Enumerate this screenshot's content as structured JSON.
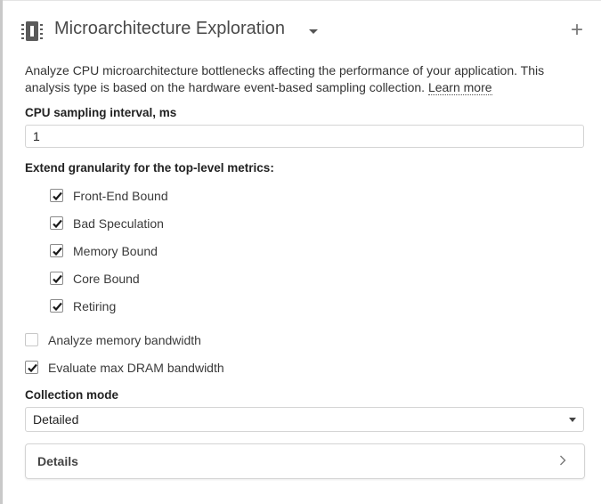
{
  "header": {
    "title": "Microarchitecture Exploration",
    "icon": "chip-icon",
    "add_icon": "plus-icon",
    "add_glyph": "+"
  },
  "description": {
    "text": "Analyze CPU microarchitecture bottlenecks affecting the performance of your application. This analysis type is based on the hardware event-based sampling collection. ",
    "link_label": "Learn more"
  },
  "sampling_interval": {
    "label": "CPU sampling interval, ms",
    "value": "1"
  },
  "granularity": {
    "label": "Extend granularity for the top-level metrics:",
    "options": [
      {
        "label": "Front-End Bound",
        "checked": true
      },
      {
        "label": "Bad Speculation",
        "checked": true
      },
      {
        "label": "Memory Bound",
        "checked": true
      },
      {
        "label": "Core Bound",
        "checked": true
      },
      {
        "label": "Retiring",
        "checked": true
      }
    ]
  },
  "options": [
    {
      "label": "Analyze memory bandwidth",
      "checked": false
    },
    {
      "label": "Evaluate max DRAM bandwidth",
      "checked": true
    }
  ],
  "collection_mode": {
    "label": "Collection mode",
    "value": "Detailed"
  },
  "details": {
    "label": "Details",
    "icon": "chevron-right-icon"
  },
  "colors": {
    "icon_dark": "#5a5a5a",
    "border": "#d4d4d4",
    "text": "#333333"
  }
}
